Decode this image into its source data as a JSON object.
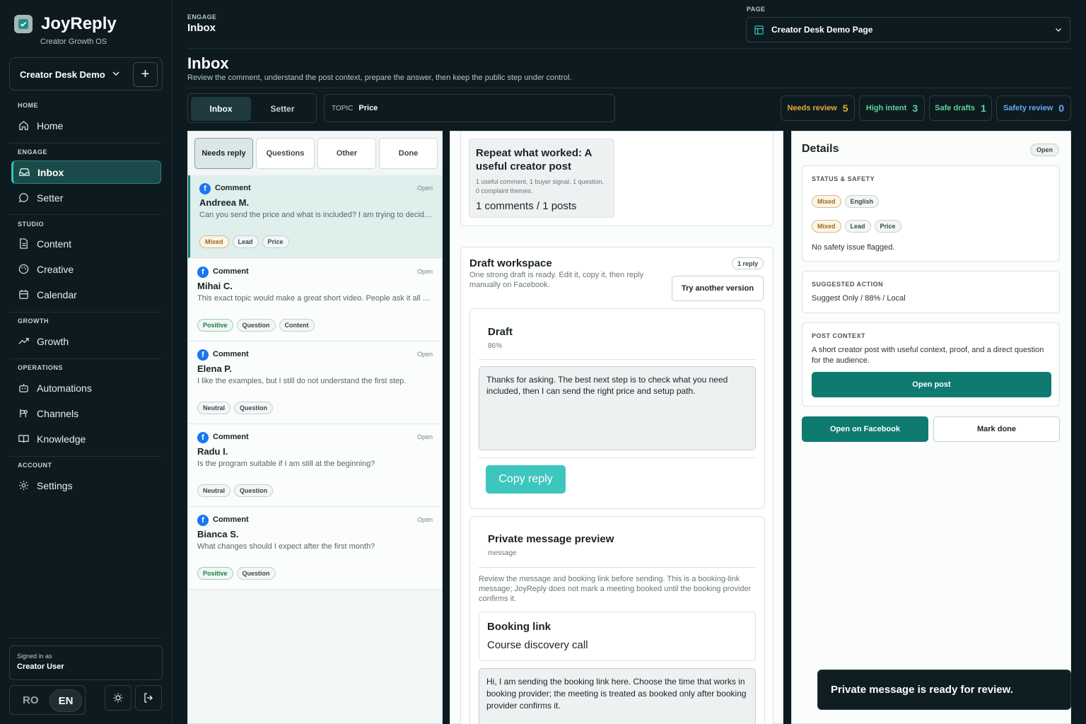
{
  "brand": {
    "name": "JoyReply",
    "tagline": "Creator Growth OS"
  },
  "workspace": {
    "name": "Creator Desk Demo",
    "add_label": "+"
  },
  "nav": {
    "sections": [
      "HOME",
      "ENGAGE",
      "STUDIO",
      "GROWTH",
      "OPERATIONS",
      "ACCOUNT"
    ],
    "items": [
      {
        "label": "Home",
        "icon": "home-icon"
      },
      {
        "label": "Inbox",
        "icon": "inbox-icon",
        "active": true
      },
      {
        "label": "Setter",
        "icon": "chat-bubble-icon"
      },
      {
        "label": "Content",
        "icon": "document-icon"
      },
      {
        "label": "Creative",
        "icon": "palette-icon"
      },
      {
        "label": "Calendar",
        "icon": "calendar-icon"
      },
      {
        "label": "Growth",
        "icon": "trend-up-icon"
      },
      {
        "label": "Automations",
        "icon": "bot-icon"
      },
      {
        "label": "Channels",
        "icon": "channels-icon"
      },
      {
        "label": "Knowledge",
        "icon": "book-icon"
      },
      {
        "label": "Settings",
        "icon": "gear-icon"
      }
    ]
  },
  "account": {
    "signed_label": "Signed in as",
    "user": "Creator User",
    "lang_ro": "RO",
    "lang_en": "EN"
  },
  "header": {
    "section": "ENGAGE",
    "title": "Inbox",
    "page_label": "PAGE",
    "page_value": "Creator Desk Demo Page"
  },
  "page": {
    "title": "Inbox",
    "description": "Review the comment, understand the post context, prepare the answer, then keep the public step under control."
  },
  "mode_tabs": [
    "Inbox",
    "Setter"
  ],
  "topic": {
    "label": "TOPIC",
    "value": "Price"
  },
  "stats": [
    {
      "label": "Needs review",
      "value": "5",
      "color": "#e8a83a"
    },
    {
      "label": "High intent",
      "value": "3",
      "color": "#5ed39a"
    },
    {
      "label": "Safe drafts",
      "value": "1",
      "color": "#5ed39a"
    },
    {
      "label": "Safety review",
      "value": "0",
      "color": "#6aa8f0"
    }
  ],
  "filters": [
    "Needs reply",
    "Questions",
    "Other",
    "Done"
  ],
  "comments": [
    {
      "type": "Comment",
      "status": "Open",
      "name": "Andreea M.",
      "text": "Can you send the price and what is included? I am trying to decide if this is the right fit.",
      "tags": [
        "Mixed",
        "Lead",
        "Price"
      ]
    },
    {
      "type": "Comment",
      "status": "Open",
      "name": "Mihai C.",
      "text": "This exact topic would make a great short video. People ask it all the time.",
      "tags": [
        "Positive",
        "Question",
        "Content"
      ]
    },
    {
      "type": "Comment",
      "status": "Open",
      "name": "Elena P.",
      "text": "I like the examples, but I still do not understand the first step.",
      "tags": [
        "Neutral",
        "Question"
      ]
    },
    {
      "type": "Comment",
      "status": "Open",
      "name": "Radu I.",
      "text": "Is the program suitable if I am still at the beginning?",
      "tags": [
        "Neutral",
        "Question"
      ]
    },
    {
      "type": "Comment",
      "status": "Open",
      "name": "Bianca S.",
      "text": "What changes should I expect after the first month?",
      "tags": [
        "Positive",
        "Question"
      ]
    }
  ],
  "context": {
    "title": "Repeat what worked: A useful creator post",
    "subtitle": "1 useful comment, 1 buyer signal, 1 question, 0 complaint themes.",
    "count": "1 comments / 1 posts"
  },
  "draft_workspace": {
    "title": "Draft workspace",
    "subtitle": "One strong draft is ready. Edit it, copy it, then reply manually on Facebook.",
    "badge": "1 reply",
    "try_label": "Try another version",
    "draft_title": "Draft",
    "draft_score": "86%",
    "draft_text": "Thanks for asking. The best next step is to check what you need included, then I can send the right price and setup path.",
    "copy_label": "Copy reply"
  },
  "private_message": {
    "title": "Private message preview",
    "subtitle": "message",
    "description": "Review the message and booking link before sending. This is a booking-link message; JoyReply does not mark a meeting booked until the booking provider confirms it.",
    "booking_title": "Booking link",
    "booking_value": "Course discovery call",
    "message_text": "Hi, I am sending the booking link here. Choose the time that works in booking provider; the meeting is treated as booked only after booking provider confirms it."
  },
  "details": {
    "title": "Details",
    "badge": "Open",
    "status_section": "STATUS & SAFETY",
    "status_tags_1": [
      "Mixed",
      "English"
    ],
    "status_tags_2": [
      "Mixed",
      "Lead",
      "Price"
    ],
    "safety_text": "No safety issue flagged.",
    "action_section": "SUGGESTED ACTION",
    "action_text": "Suggest Only / 88% / Local",
    "post_section": "POST CONTEXT",
    "post_text": "A short creator post with useful context, proof, and a direct question for the audience.",
    "open_post_label": "Open post",
    "open_facebook_label": "Open on Facebook",
    "mark_done_label": "Mark done"
  },
  "toast": "Private message is ready for review."
}
